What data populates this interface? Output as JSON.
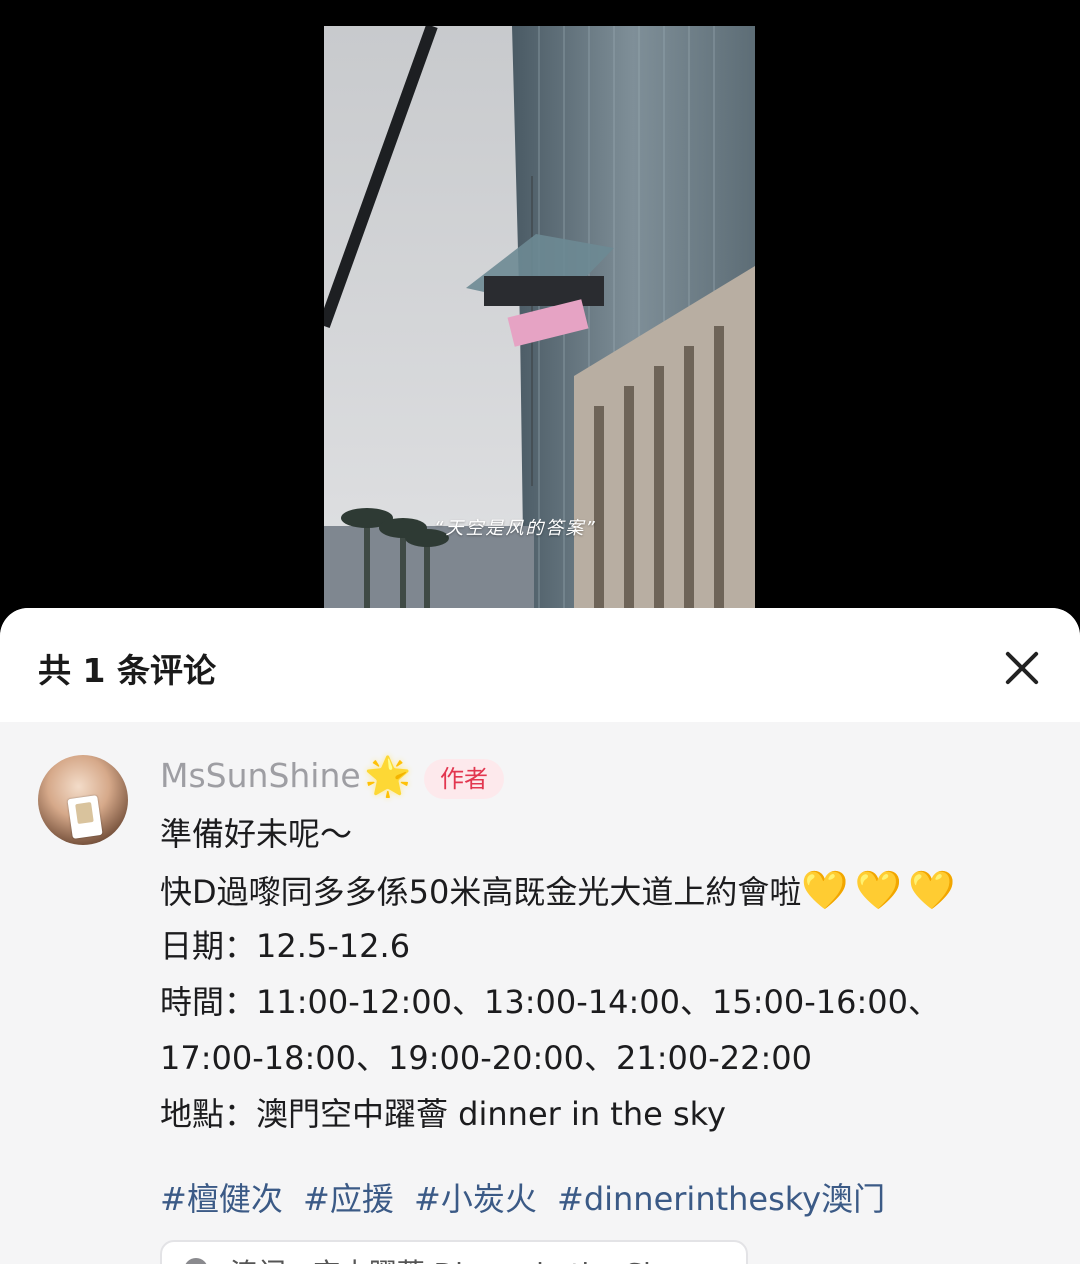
{
  "video": {
    "caption": "“天空是风的答案”"
  },
  "comments_panel": {
    "title": "共 1 条评论",
    "close_icon": "close-icon"
  },
  "comment": {
    "username": "MsSunShine",
    "username_icon": "sparkle-star-icon",
    "badge": "作者",
    "lines": [
      "準備好未呢～",
      "快D過嚟同多多係50米高既金光大道上約會啦",
      "日期：12.5-12.6",
      "時間：11:00-12:00、13:00-14:00、15:00-16:00、",
      "17:00-18:00、19:00-20:00、21:00-22:00",
      "地點：澳門空中躍薈 dinner in the sky"
    ],
    "hearts": "💛💛💛",
    "tags": [
      "#檀健次",
      "#应援",
      "#小炭火",
      "#dinnerinthesky澳门"
    ],
    "link_preview": "澳门 · 空中躍薈 Dinner in the Sky"
  },
  "colors": {
    "badge_text": "#e2364f",
    "badge_bg": "#fde9ec",
    "tag_color": "#3b5a86",
    "username_color": "#9e9ea3"
  }
}
